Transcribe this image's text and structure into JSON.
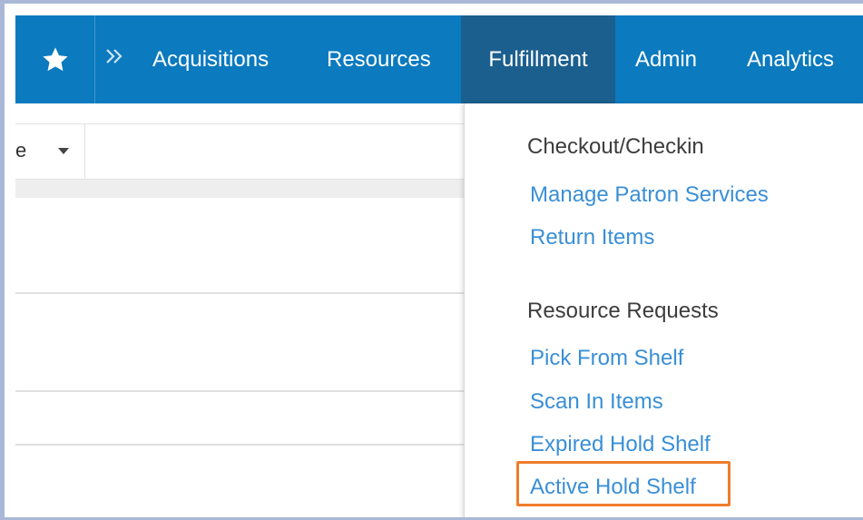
{
  "navbar": {
    "favorites_icon": "star-icon",
    "expand_icon": "double-chevron-right-icon",
    "items": [
      {
        "label": "Acquisitions"
      },
      {
        "label": "Resources"
      },
      {
        "label": "Fulfillment",
        "active": true
      },
      {
        "label": "Admin"
      },
      {
        "label": "Analytics"
      }
    ]
  },
  "left_panel": {
    "filter_text": "e",
    "filter_caret_icon": "caret-down-icon"
  },
  "fulfillment_menu": {
    "sections": [
      {
        "heading": "Checkout/Checkin",
        "links": [
          "Manage Patron Services",
          "Return Items"
        ]
      },
      {
        "heading": "Resource Requests",
        "links": [
          "Pick From Shelf",
          "Scan In Items",
          "Expired Hold Shelf",
          "Active Hold Shelf"
        ]
      }
    ],
    "highlighted_link": "Active Hold Shelf"
  },
  "colors": {
    "navbar_bg": "#0b7abf",
    "navbar_active_bg": "#1b5f8e",
    "link": "#3a8fd6",
    "highlight": "#ef7d2b"
  }
}
